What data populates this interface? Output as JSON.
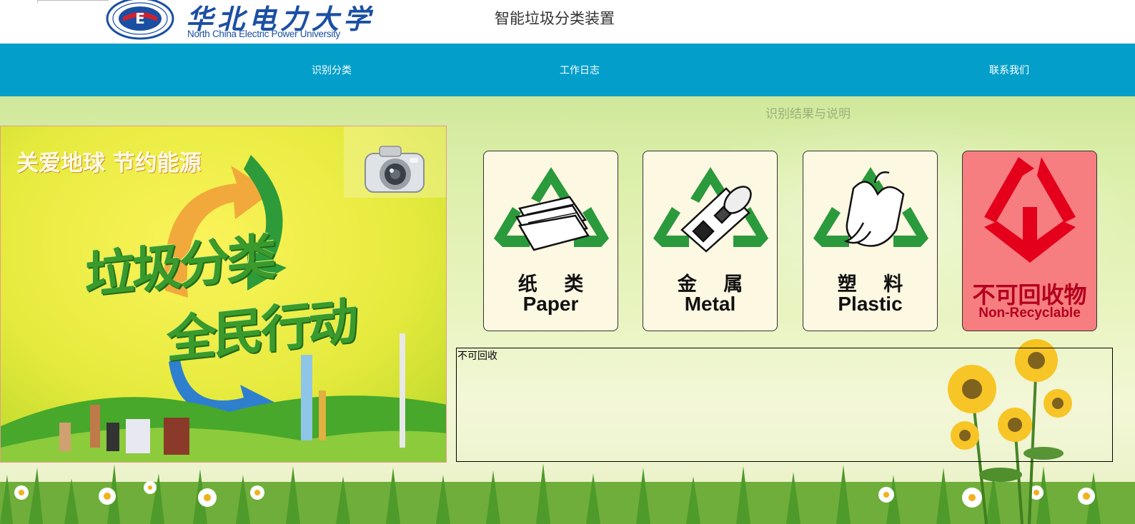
{
  "header": {
    "university_name_cn": "华北电力大学",
    "university_name_en": "North China Electric Power University",
    "app_title": "智能垃圾分类装置"
  },
  "nav": {
    "items": [
      {
        "label": "识别分类"
      },
      {
        "label": "工作日志"
      },
      {
        "label": "联系我们"
      }
    ]
  },
  "main": {
    "result_title": "识别结果与说明",
    "poster": {
      "slogan_top": "关爱地球 节约能源",
      "slogan_line1": "垃圾分类",
      "slogan_line2": "全民行动",
      "icon": "camera-icon"
    },
    "categories": [
      {
        "label_cn": "纸 类",
        "label_en": "Paper",
        "icon": "paper-recycle-icon"
      },
      {
        "label_cn": "金 属",
        "label_en": "Metal",
        "icon": "metal-recycle-icon"
      },
      {
        "label_cn": "塑 料",
        "label_en": "Plastic",
        "icon": "plastic-recycle-icon"
      },
      {
        "label_cn": "不可回收物",
        "label_en": "Non-Recyclable",
        "icon": "non-recyclable-icon"
      }
    ],
    "result_text": "不可回收"
  },
  "colors": {
    "nav_bg": "#039fca",
    "recycle_green": "#2a9a3c",
    "nonrecyclable_red": "#e4001b",
    "nonrecyclable_bg": "#f67e80",
    "card_bg": "#fdf8e2"
  }
}
